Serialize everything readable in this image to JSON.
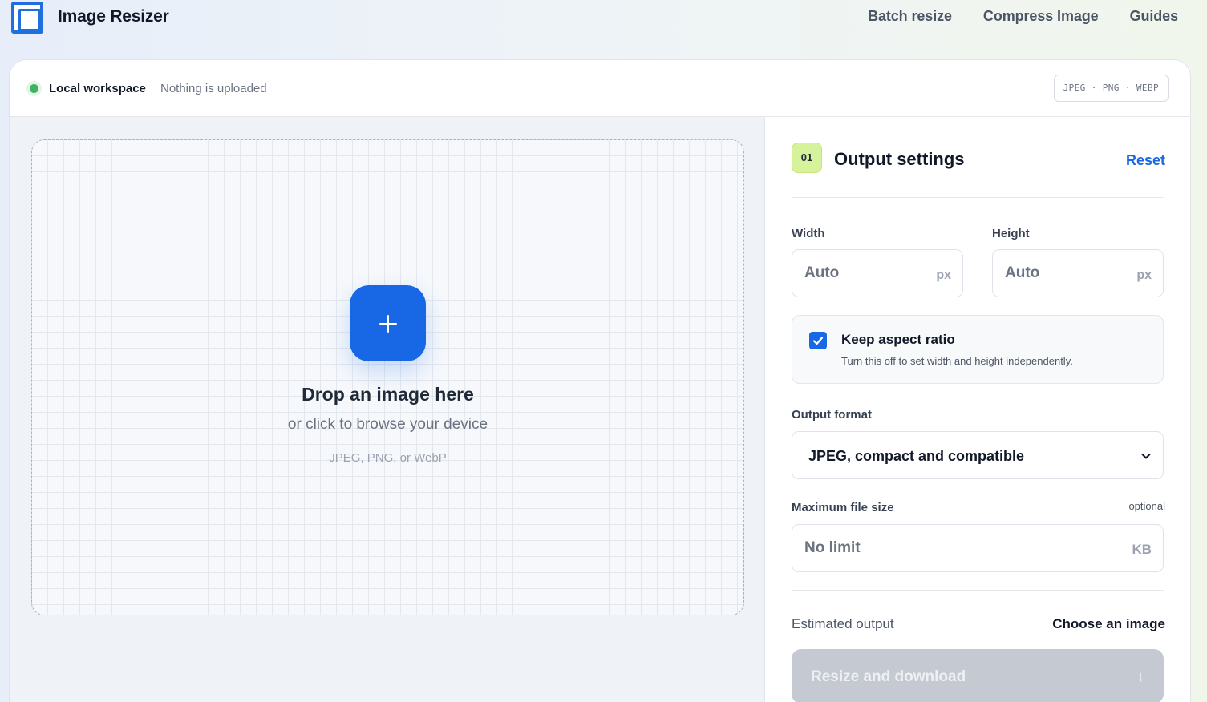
{
  "header": {
    "app_title": "Image Resizer",
    "nav": [
      {
        "label": "Batch resize"
      },
      {
        "label": "Compress Image"
      },
      {
        "label": "Guides"
      }
    ]
  },
  "status_bar": {
    "workspace_label": "Local workspace",
    "upload_status": "Nothing is uploaded",
    "formats_badge": "JPEG · PNG · WEBP"
  },
  "dropzone": {
    "title": "Drop an image here",
    "subtitle": "or click to browse your device",
    "formats": "JPEG, PNG, or WebP",
    "button_icon": "plus-icon"
  },
  "settings": {
    "step": "01",
    "title": "Output settings",
    "reset_label": "Reset",
    "width": {
      "label": "Width",
      "placeholder": "Auto",
      "unit": "px"
    },
    "height": {
      "label": "Height",
      "placeholder": "Auto",
      "unit": "px"
    },
    "separator": "×",
    "aspect": {
      "checked": true,
      "title": "Keep aspect ratio",
      "description": "Turn this off to set width and height independently."
    },
    "format": {
      "label": "Output format",
      "value": "JPEG, compact and compatible"
    },
    "max_size": {
      "label": "Maximum file size",
      "optional": "optional",
      "placeholder": "No limit",
      "unit": "KB"
    },
    "estimate": {
      "label": "Estimated output",
      "value": "Choose an image"
    },
    "download": {
      "label": "Resize and download",
      "arrow": "↓",
      "enabled": false
    }
  },
  "colors": {
    "accent": "#1868e6",
    "status_green": "#3fb25f",
    "step_badge": "#d6f29a",
    "disabled_button": "#c5cad2"
  }
}
